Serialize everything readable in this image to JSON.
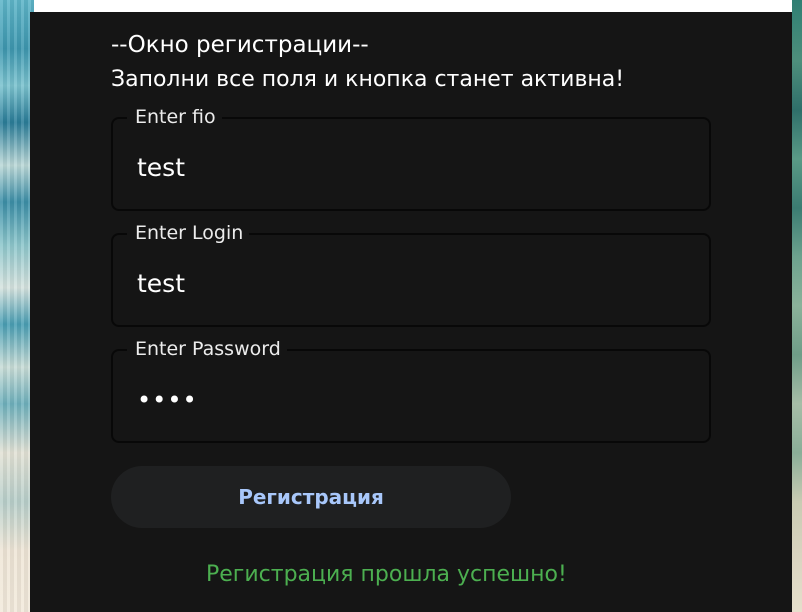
{
  "form": {
    "title": "--Окно регистрации--",
    "subtitle": "Заполни все поля и кнопка станет активна!",
    "fields": [
      {
        "label": "Enter fio",
        "value": "test"
      },
      {
        "label": "Enter Login",
        "value": "test"
      },
      {
        "label": "Enter Password",
        "value": "••••"
      }
    ],
    "submit_label": "Регистрация",
    "status_message": "Регистрация прошла успешно!"
  },
  "colors": {
    "panel_background": "#151515",
    "button_background": "#1f2021",
    "button_text": "#a8c7fa",
    "status_text": "#4caf50"
  }
}
